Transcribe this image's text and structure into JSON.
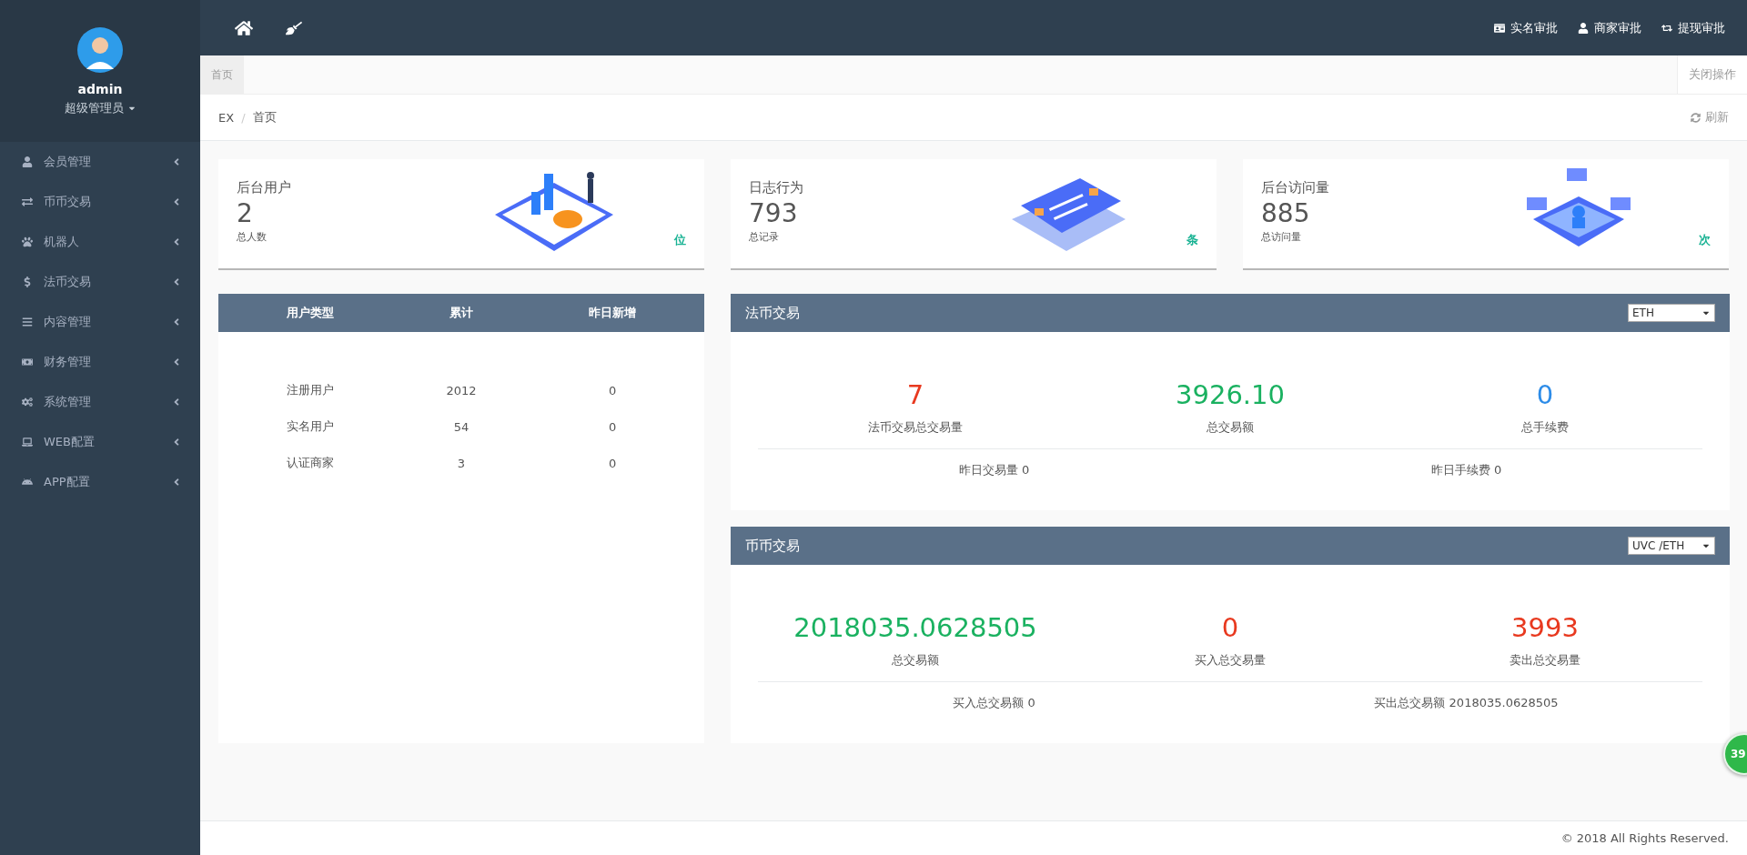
{
  "user": {
    "name": "admin",
    "role": "超级管理员"
  },
  "sidebar": {
    "items": [
      {
        "label": "会员管理"
      },
      {
        "label": "币币交易"
      },
      {
        "label": "机器人"
      },
      {
        "label": "法币交易"
      },
      {
        "label": "内容管理"
      },
      {
        "label": "财务管理"
      },
      {
        "label": "系统管理"
      },
      {
        "label": "WEB配置"
      },
      {
        "label": "APP配置"
      }
    ]
  },
  "header": {
    "links": [
      {
        "label": "实名审批"
      },
      {
        "label": "商家审批"
      },
      {
        "label": "提现审批"
      }
    ]
  },
  "tabs": [
    {
      "label": "首页",
      "selected": true
    }
  ],
  "close_tabs": "关闭操作",
  "breadcrumb": [
    "EX",
    "首页"
  ],
  "breadcrumb_separator": "/",
  "refresh": "刷新",
  "cards": [
    {
      "title": "后台用户",
      "value": "2",
      "caption": "总人数",
      "unit": "位"
    },
    {
      "title": "日志行为",
      "value": "793",
      "caption": "总记录",
      "unit": "条"
    },
    {
      "title": "后台访问量",
      "value": "885",
      "caption": "总访问量",
      "unit": "次"
    }
  ],
  "user_table": {
    "columns": [
      "用户类型",
      "累计",
      "昨日新增"
    ],
    "rows": [
      [
        "注册用户",
        "2012",
        "0"
      ],
      [
        "实名用户",
        "54",
        "0"
      ],
      [
        "认证商家",
        "3",
        "0"
      ]
    ]
  },
  "panels": [
    {
      "title": "法币交易",
      "select": "ETH",
      "stats": [
        {
          "value": "7",
          "label": "法币交易总交易量",
          "color": "#e8391f"
        },
        {
          "value": "3926.10",
          "label": "总交易额",
          "color": "#1ab160"
        },
        {
          "value": "0",
          "label": "总手续费",
          "color": "#2d8ce8"
        }
      ],
      "footer": [
        "昨日交易量 0",
        "昨日手续费 0"
      ]
    },
    {
      "title": "币币交易",
      "select": "UVC /ETH",
      "stats": [
        {
          "value": "2018035.0628505",
          "label": "总交易额",
          "color": "#1ab160"
        },
        {
          "value": "0",
          "label": "买入总交易量",
          "color": "#e8391f"
        },
        {
          "value": "3993",
          "label": "卖出总交易量",
          "color": "#e8391f"
        }
      ],
      "footer": [
        "买入总交易额 0",
        "买出总交易额 2018035.0628505"
      ]
    }
  ],
  "float_badge": "39",
  "footer": "© 2018 All Rights Reserved."
}
